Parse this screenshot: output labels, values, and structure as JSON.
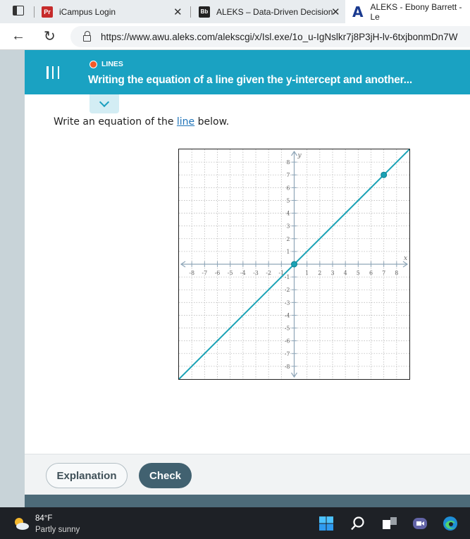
{
  "browser": {
    "tabs": [
      {
        "favicon": "Pr",
        "title": "iCampus Login",
        "close": "✕"
      },
      {
        "favicon": "Bb",
        "title": "ALEKS – Data-Driven Decision",
        "close": "✕"
      },
      {
        "favicon": "A",
        "title": "ALEKS - Ebony Barrett - Le"
      }
    ],
    "url": "https://www.awu.aleks.com/alekscgi/x/Isl.exe/1o_u-IgNslkr7j8P3jH-lv-6txjbonmDn7W"
  },
  "header": {
    "topic": "LINES",
    "title": "Writing the equation of a line given the y-intercept and another..."
  },
  "problem": {
    "prompt_before": "Write an equation of the ",
    "prompt_link": "line",
    "prompt_after": " below."
  },
  "chart_data": {
    "type": "line",
    "xlabel": "x",
    "ylabel": "y",
    "xlim": [
      -9,
      9
    ],
    "ylim": [
      -9,
      9
    ],
    "grid": true,
    "x_ticks": [
      -8,
      -7,
      -6,
      -5,
      -4,
      -3,
      -2,
      -1,
      1,
      2,
      3,
      4,
      5,
      6,
      7,
      8
    ],
    "y_ticks": [
      -8,
      -7,
      -6,
      -5,
      -4,
      -3,
      -2,
      -1,
      1,
      2,
      3,
      4,
      5,
      6,
      7,
      8
    ],
    "series": [
      {
        "x": [
          -9,
          9
        ],
        "y": [
          -9,
          9
        ],
        "color": "#1aa2b5"
      }
    ],
    "points": [
      {
        "x": 0,
        "y": 0
      },
      {
        "x": 7,
        "y": 7
      }
    ]
  },
  "buttons": {
    "explanation": "Explanation",
    "check": "Check"
  },
  "taskbar": {
    "temperature": "84°F",
    "condition": "Partly sunny"
  }
}
